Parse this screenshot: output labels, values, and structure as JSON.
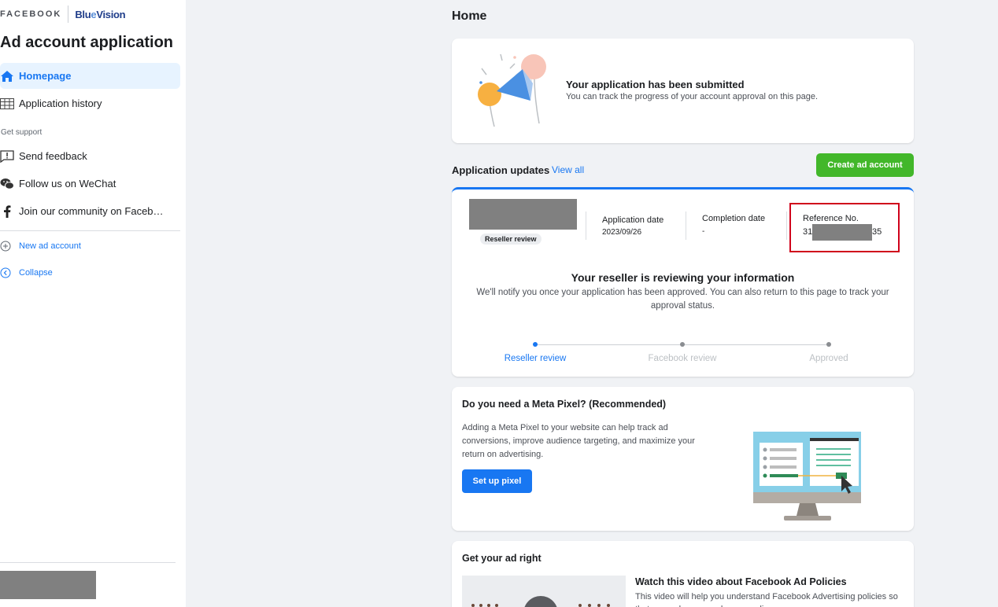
{
  "sidebar": {
    "brand": {
      "facebook": "FACEBOOK",
      "bluevision_a": "Blu",
      "bluevision_b": "e",
      "bluevision_c": "Vision"
    },
    "app_title": "Ad account application",
    "nav": [
      {
        "label": "Homepage",
        "icon": "home-icon",
        "active": true
      },
      {
        "label": "Application history",
        "icon": "table-icon",
        "active": false
      }
    ],
    "support_label": "Get support",
    "support": [
      {
        "label": "Send feedback",
        "icon": "feedback-icon"
      },
      {
        "label": "Follow us on WeChat",
        "icon": "wechat-icon"
      },
      {
        "label": "Join our community on Faceb…",
        "icon": "facebook-icon"
      }
    ],
    "links": [
      {
        "label": "New ad account",
        "icon": "plus-circle-icon"
      },
      {
        "label": "Collapse",
        "icon": "chevron-left-circle-icon"
      }
    ]
  },
  "main": {
    "page_title": "Home",
    "submitted": {
      "title": "Your application has been submitted",
      "subtitle": "You can track the progress of your account approval on this page."
    },
    "updates": {
      "header": "Application updates",
      "view_all": "View all",
      "create_button": "Create ad account",
      "badge": "Reseller review",
      "application_date_label": "Application date",
      "application_date": "2023/09/26",
      "completion_date_label": "Completion date",
      "completion_date": "-",
      "reference_label": "Reference No.",
      "reference_prefix": "31",
      "reference_suffix": "35",
      "review_title": "Your reseller is reviewing your information",
      "review_sub": "We'll notify you once your application has been approved. You can also return to this page to track your approval status.",
      "steps": [
        "Reseller review",
        "Facebook review",
        "Approved"
      ],
      "current_step": 0
    },
    "pixel": {
      "title": "Do you need a Meta Pixel? (Recommended)",
      "description": "Adding a Meta Pixel to your website can help track ad conversions, improve audience targeting, and maximize your return on advertising.",
      "button": "Set up pixel"
    },
    "ad_right": {
      "title": "Get your ad right",
      "video_title": "Watch this video about Facebook Ad Policies",
      "video_sub": "This video will help you understand Facebook Advertising policies so that your ads can reach your audience."
    }
  },
  "colors": {
    "accent": "#1877f2",
    "green": "#42b72a",
    "highlight": "#d0021b",
    "active_bg": "#e7f3ff"
  }
}
